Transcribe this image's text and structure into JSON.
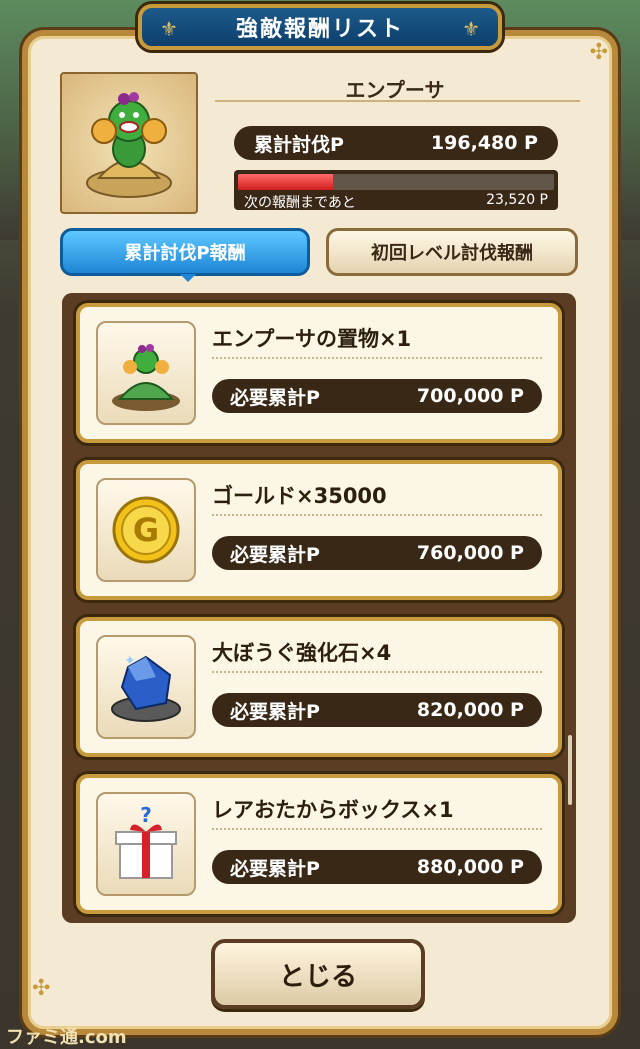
{
  "header": {
    "title": "強敵報酬リスト"
  },
  "monster": {
    "name": "エンプーサ",
    "total_label": "累計討伐P",
    "total_value": "196,480 P",
    "next_label": "次の報酬まであと",
    "next_value": "23,520 P",
    "progress_fraction": 0.3
  },
  "tabs": [
    {
      "label": "累計討伐P報酬",
      "active": true
    },
    {
      "label": "初回レベル討伐報酬",
      "active": false
    }
  ],
  "rewards": [
    {
      "name": "エンプーサの置物×1",
      "req_label": "必要累計P",
      "req_value": "700,000 P",
      "icon": "monster-figure-icon"
    },
    {
      "name": "ゴールド×35000",
      "req_label": "必要累計P",
      "req_value": "760,000 P",
      "icon": "gold-coin-icon"
    },
    {
      "name": "大ぼうぐ強化石×4",
      "req_label": "必要累計P",
      "req_value": "820,000 P",
      "icon": "blue-stone-icon"
    },
    {
      "name": "レアおたからボックス×1",
      "req_label": "必要累計P",
      "req_value": "880,000 P",
      "icon": "mystery-gift-icon"
    }
  ],
  "footer": {
    "close_label": "とじる",
    "watermark": "ファミ通.com"
  },
  "colors": {
    "accent_blue": "#1e86d6",
    "bar_dark": "#3a2817",
    "progress_red": "#d11d1d",
    "gold_border": "#c89a3e"
  }
}
